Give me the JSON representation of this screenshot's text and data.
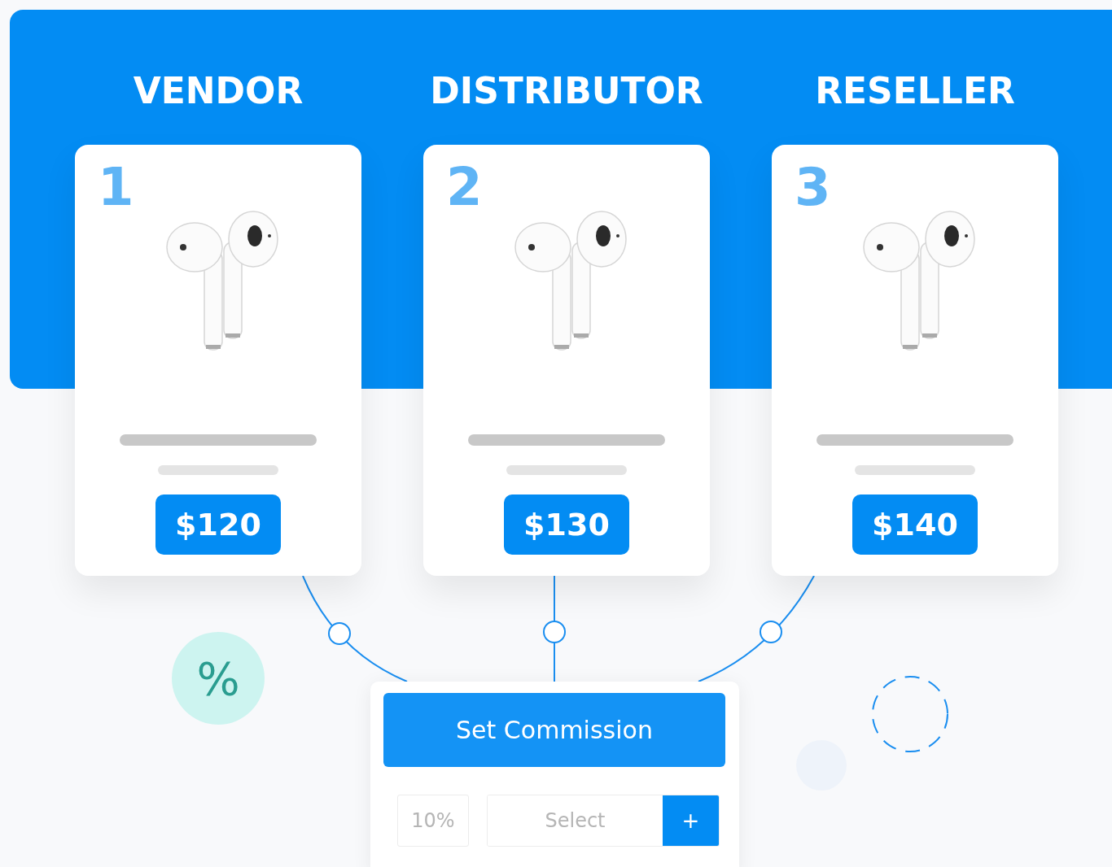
{
  "tiers": [
    {
      "role": "VENDOR",
      "number": "1",
      "price": "$120"
    },
    {
      "role": "DISTRIBUTOR",
      "number": "2",
      "price": "$130"
    },
    {
      "role": "RESELLER",
      "number": "3",
      "price": "$140"
    }
  ],
  "percent_badge": "%",
  "commission": {
    "button": "Set Commission",
    "rate": {
      "value": "10%"
    },
    "select": {
      "placeholder": "Select"
    },
    "add_button": "+"
  }
}
